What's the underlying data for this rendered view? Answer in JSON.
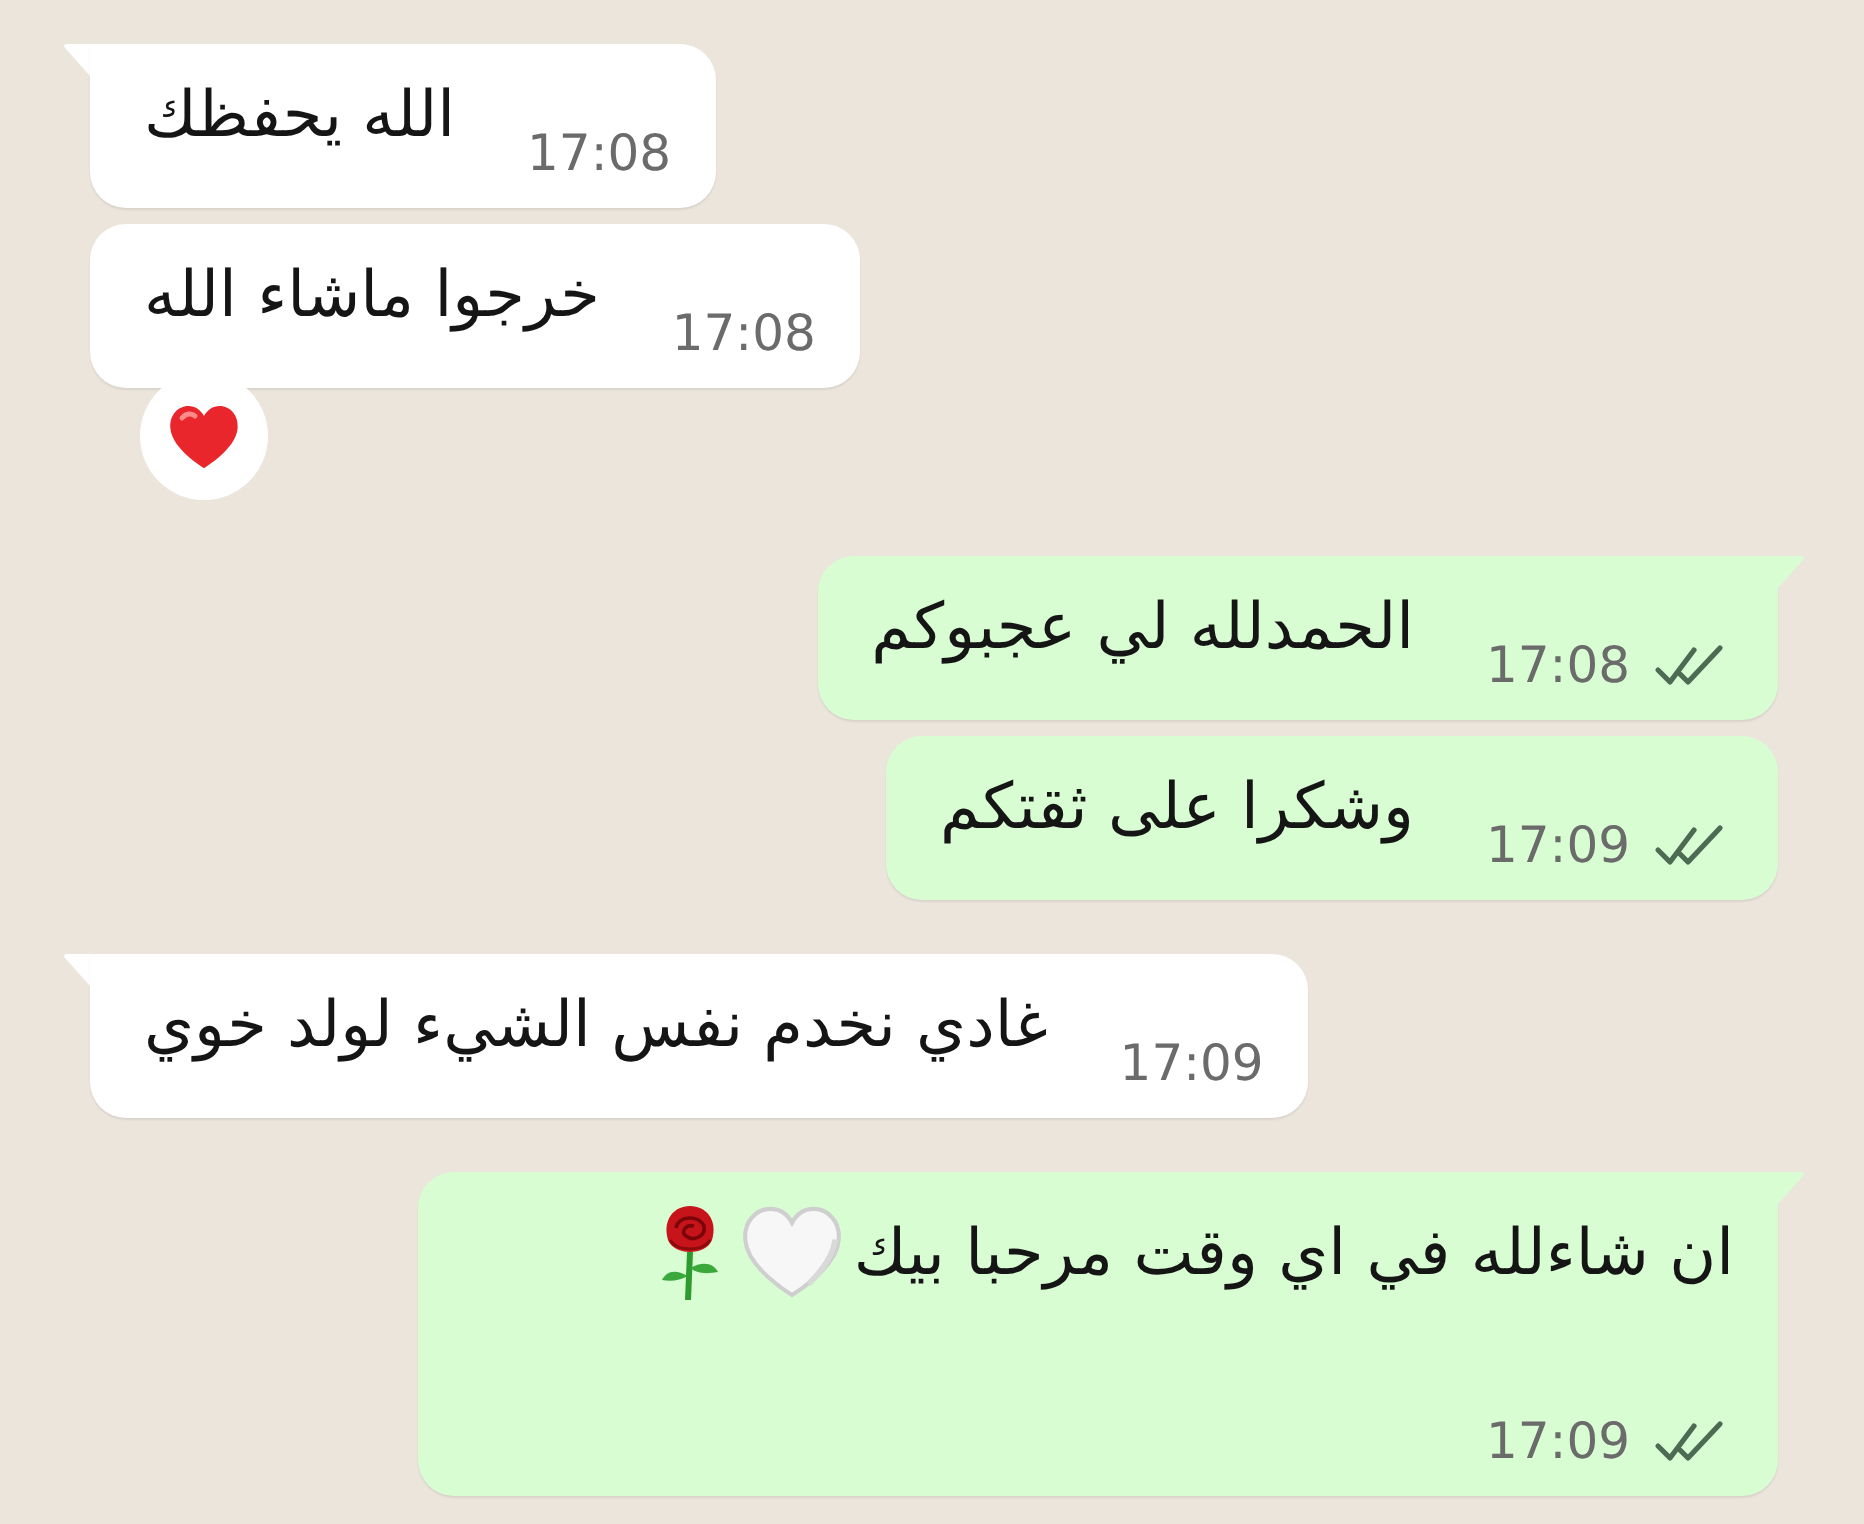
{
  "chat": {
    "messages": [
      {
        "kind": "incoming",
        "tail": true,
        "text": "الله يحفظك",
        "time": "17:08"
      },
      {
        "kind": "incoming",
        "tail": false,
        "text": "خرجوا ماشاء الله",
        "time": "17:08",
        "reaction": {
          "kind": "red-heart"
        }
      },
      {
        "kind": "outgoing",
        "tail": true,
        "text": "الحمدلله لي عجبوكم",
        "time": "17:08",
        "delivered": true,
        "read": false
      },
      {
        "kind": "outgoing",
        "tail": false,
        "text": "وشكرا على ثقتكم",
        "time": "17:09",
        "delivered": true,
        "read": false
      },
      {
        "kind": "incoming",
        "tail": true,
        "text": "غادي نخدم نفس الشيء لولد خوي",
        "time": "17:09"
      },
      {
        "kind": "outgoing",
        "tail": true,
        "text": "ان شاءلله في اي وقت مرحبا بيك",
        "emojis": [
          {
            "kind": "white-heart"
          },
          {
            "kind": "rose"
          }
        ],
        "time": "17:09",
        "delivered": true,
        "read": false
      }
    ]
  }
}
